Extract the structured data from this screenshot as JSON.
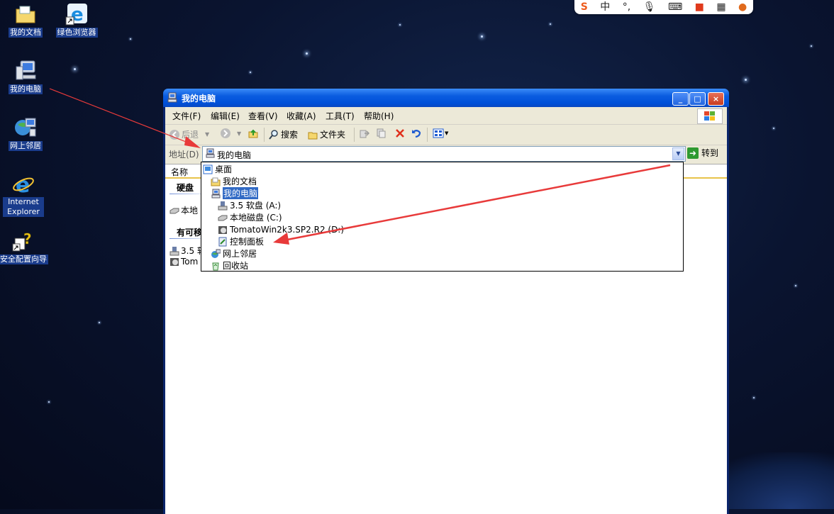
{
  "desktop": {
    "icons": [
      {
        "label": "我的文档"
      },
      {
        "label": "绿色浏览器"
      },
      {
        "label": "我的电脑"
      },
      {
        "label": "网上邻居"
      },
      {
        "label": "Internet Explorer"
      },
      {
        "label": "安全配置向导"
      }
    ]
  },
  "ime_bar": {
    "items": [
      "S",
      "中",
      "°,",
      "mic",
      "keyboard",
      "skin",
      "apps",
      "avatar"
    ]
  },
  "window": {
    "title": "我的电脑",
    "controls": {
      "minimize": "_",
      "maximize": "□",
      "close": "×"
    },
    "menu": [
      "文件(F)",
      "编辑(E)",
      "查看(V)",
      "收藏(A)",
      "工具(T)",
      "帮助(H)"
    ],
    "toolbar": {
      "back": "后退",
      "search": "搜索",
      "folders": "文件夹"
    },
    "address": {
      "label": "地址(D)",
      "value": "我的电脑",
      "go": "转到"
    },
    "list": {
      "column_name": "名称",
      "group_hard_disks": "硬盘",
      "group_removable": "有可移",
      "items": [
        "本地",
        "3.5 软",
        "Tom"
      ]
    }
  },
  "address_dropdown": {
    "items": [
      {
        "label": "桌面",
        "level": 0,
        "icon": "desktop-icon"
      },
      {
        "label": "我的文档",
        "level": 1,
        "icon": "folder-icon"
      },
      {
        "label": "我的电脑",
        "level": 1,
        "icon": "computer-icon",
        "selected": true
      },
      {
        "label": "3.5 软盘 (A:)",
        "level": 2,
        "icon": "floppy-icon"
      },
      {
        "label": "本地磁盘 (C:)",
        "level": 2,
        "icon": "hard-disk-icon"
      },
      {
        "label": "TomatoWin2k3.SP2.R2 (D:)",
        "level": 2,
        "icon": "cd-drive-icon"
      },
      {
        "label": "控制面板",
        "level": 2,
        "icon": "control-panel-icon"
      },
      {
        "label": "网上邻居",
        "level": 1,
        "icon": "network-icon"
      },
      {
        "label": "回收站",
        "level": 1,
        "icon": "recycle-bin-icon"
      }
    ]
  },
  "colors": {
    "annotation_arrow": "#e83a3a",
    "selection": "#316ac5",
    "titlebar": "#0a5ce0"
  }
}
